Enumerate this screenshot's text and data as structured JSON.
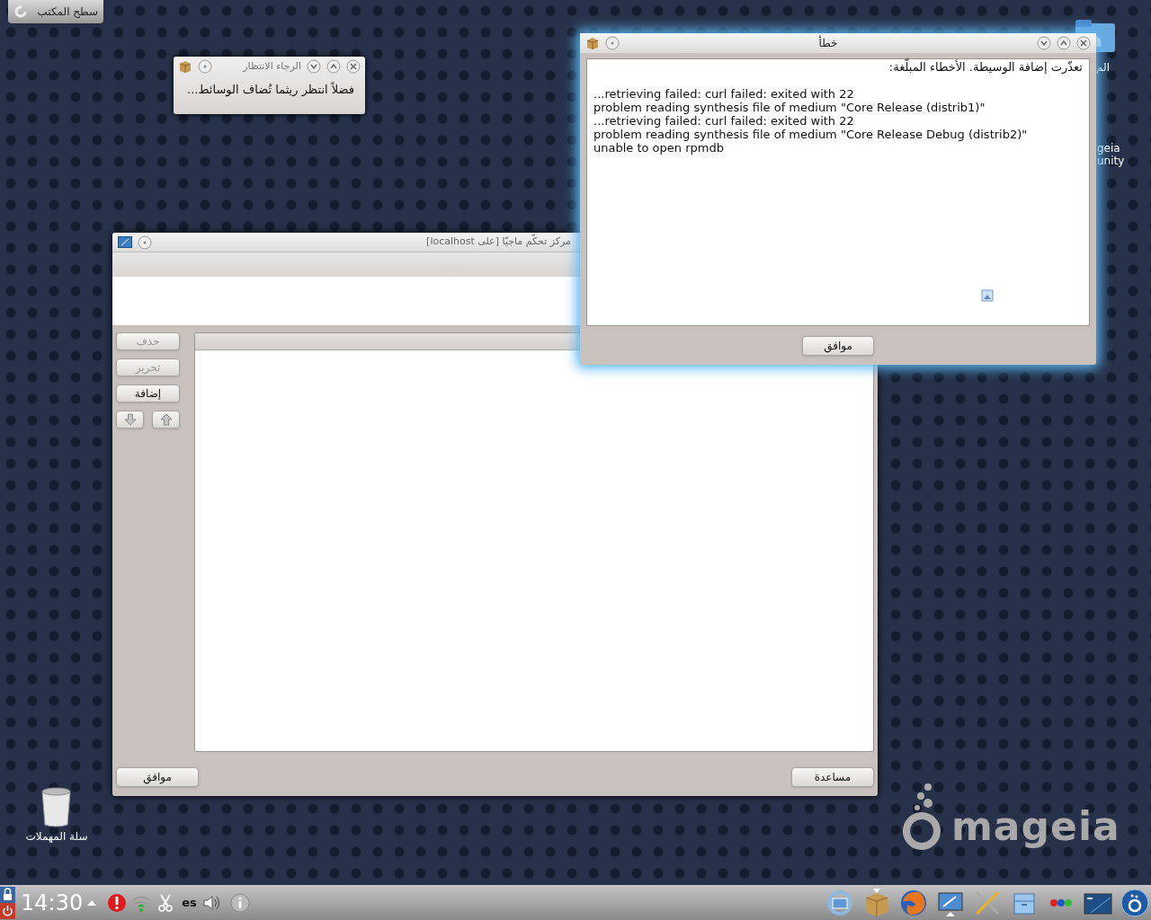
{
  "desktop": {
    "show_desktop_button": "سطح المكتب",
    "trash_label": "سلة المهملات",
    "partial_labels": [
      "الم",
      "geia",
      "unity"
    ],
    "wallpaper_logo": "mageia"
  },
  "wait_dialog": {
    "title": "الرجاء الانتظار",
    "message": "فضلاً انتظر ريثما تُضاف الوسائط..."
  },
  "main_window": {
    "title": "مركز تحكّم ماجيّا  [على localhost]",
    "side_buttons": [
      {
        "label": "حذف",
        "disabled": true
      },
      {
        "label": "تحرير",
        "disabled": true
      },
      {
        "label": "إضافة",
        "disabled": false
      }
    ],
    "arrow_buttons": [
      {
        "kind": "down",
        "disabled": true
      },
      {
        "kind": "up",
        "disabled": true
      }
    ],
    "footer_buttons": [
      "مساعدة",
      "موافق"
    ]
  },
  "error_dialog": {
    "title": "خطأ",
    "heading": "تعذّرت إضافة الوسيطة. الأخطاء المبلّغة:",
    "lines": [
      "...retrieving failed: curl failed: exited with 22",
      "problem reading synthesis file of medium \"Core Release (distrib1)\"",
      "...retrieving failed: curl failed: exited with 22",
      "problem reading synthesis file of medium \"Core Release Debug (distrib2)\"",
      "unable to open rpmdb"
    ],
    "ok_button": "موافق"
  },
  "taskbar": {
    "clock": "14:30",
    "keyboard_layout": "es"
  }
}
